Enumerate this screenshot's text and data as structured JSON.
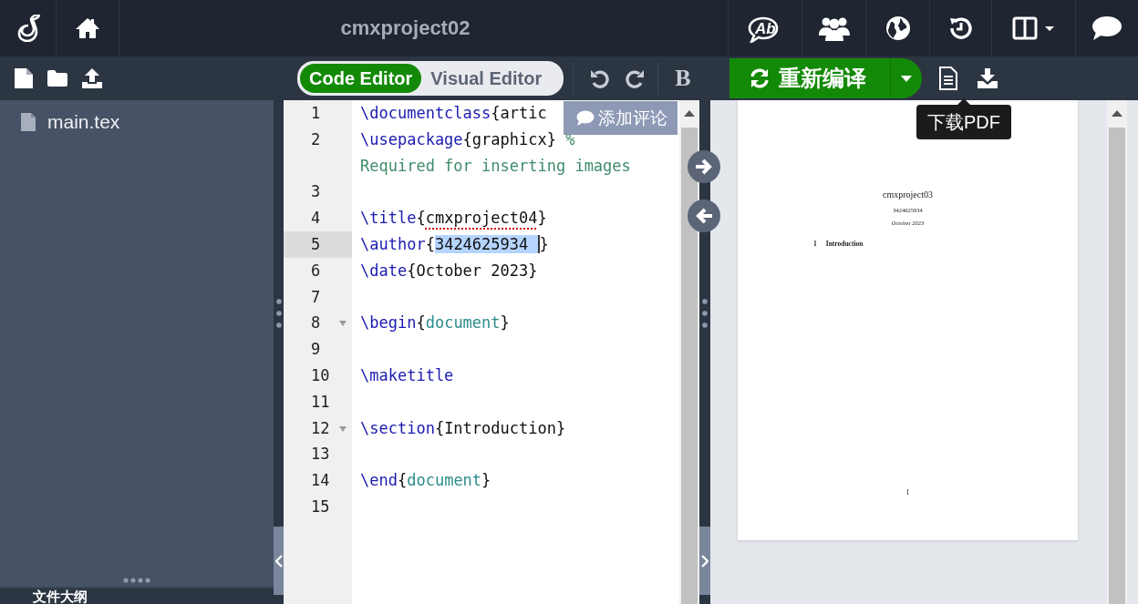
{
  "topbar": {
    "title": "cmxproject02",
    "review_label": "Ab"
  },
  "toolbar": {
    "editor_modes": [
      {
        "label": "Code Editor",
        "selected": true
      },
      {
        "label": "Visual Editor",
        "selected": false
      }
    ],
    "bold_label": "B",
    "compile_button": {
      "label": "重新编译"
    },
    "tooltip": "下载PDF"
  },
  "file_tree": {
    "items": [
      {
        "name": "main.tex"
      }
    ]
  },
  "outline": {
    "title": "文件大纲"
  },
  "editor": {
    "comment_button": "添加评论",
    "lines": [
      {
        "number": "1",
        "active": false,
        "foldable": false,
        "tokens": [
          {
            "kind": "command",
            "text": "\\documentclass"
          },
          {
            "kind": "plain",
            "text": "{artic"
          }
        ]
      },
      {
        "number": "2",
        "active": false,
        "foldable": false,
        "tokens": [
          {
            "kind": "command",
            "text": "\\usepackage"
          },
          {
            "kind": "plain",
            "text": "{graphicx} "
          },
          {
            "kind": "comment",
            "text": "%"
          }
        ],
        "wrap": [
          {
            "kind": "comment",
            "text": "Required for inserting images"
          }
        ]
      },
      {
        "number": "3",
        "active": false,
        "foldable": false
      },
      {
        "number": "4",
        "active": false,
        "foldable": false,
        "tokens": [
          {
            "kind": "command",
            "text": "\\title"
          },
          {
            "kind": "plain",
            "text": "{"
          },
          {
            "kind": "misspelled",
            "text": "cmxproject04"
          },
          {
            "kind": "plain",
            "text": "}"
          }
        ]
      },
      {
        "number": "5",
        "active": true,
        "foldable": false,
        "tokens": [
          {
            "kind": "command",
            "text": "\\author"
          },
          {
            "kind": "plain",
            "text": "{"
          },
          {
            "kind": "selection",
            "text": "3424625934 "
          },
          {
            "kind": "plain",
            "text": "}"
          }
        ]
      },
      {
        "number": "6",
        "active": false,
        "foldable": false,
        "tokens": [
          {
            "kind": "command",
            "text": "\\date"
          },
          {
            "kind": "plain",
            "text": "{October 2023}"
          }
        ]
      },
      {
        "number": "7",
        "active": false,
        "foldable": false
      },
      {
        "number": "8",
        "active": false,
        "foldable": true,
        "tokens": [
          {
            "kind": "command",
            "text": "\\begin"
          },
          {
            "kind": "plain",
            "text": "{"
          },
          {
            "kind": "env",
            "text": "document"
          },
          {
            "kind": "plain",
            "text": "}"
          }
        ]
      },
      {
        "number": "9",
        "active": false,
        "foldable": false
      },
      {
        "number": "10",
        "active": false,
        "foldable": false,
        "tokens": [
          {
            "kind": "command",
            "text": "\\maketitle"
          }
        ]
      },
      {
        "number": "11",
        "active": false,
        "foldable": false
      },
      {
        "number": "12",
        "active": false,
        "foldable": true,
        "tokens": [
          {
            "kind": "command",
            "text": "\\section"
          },
          {
            "kind": "plain",
            "text": "{Introduction}"
          }
        ]
      },
      {
        "number": "13",
        "active": false,
        "foldable": false
      },
      {
        "number": "14",
        "active": false,
        "foldable": false,
        "tokens": [
          {
            "kind": "command",
            "text": "\\end"
          },
          {
            "kind": "plain",
            "text": "{"
          },
          {
            "kind": "env",
            "text": "document"
          },
          {
            "kind": "plain",
            "text": "}"
          }
        ]
      },
      {
        "number": "15",
        "active": false,
        "foldable": false
      }
    ]
  },
  "preview": {
    "title": "cmxproject03",
    "author": "3424625934",
    "date": "October 2023",
    "section_number": "1",
    "section_title": "Introduction",
    "page_number": "1"
  }
}
